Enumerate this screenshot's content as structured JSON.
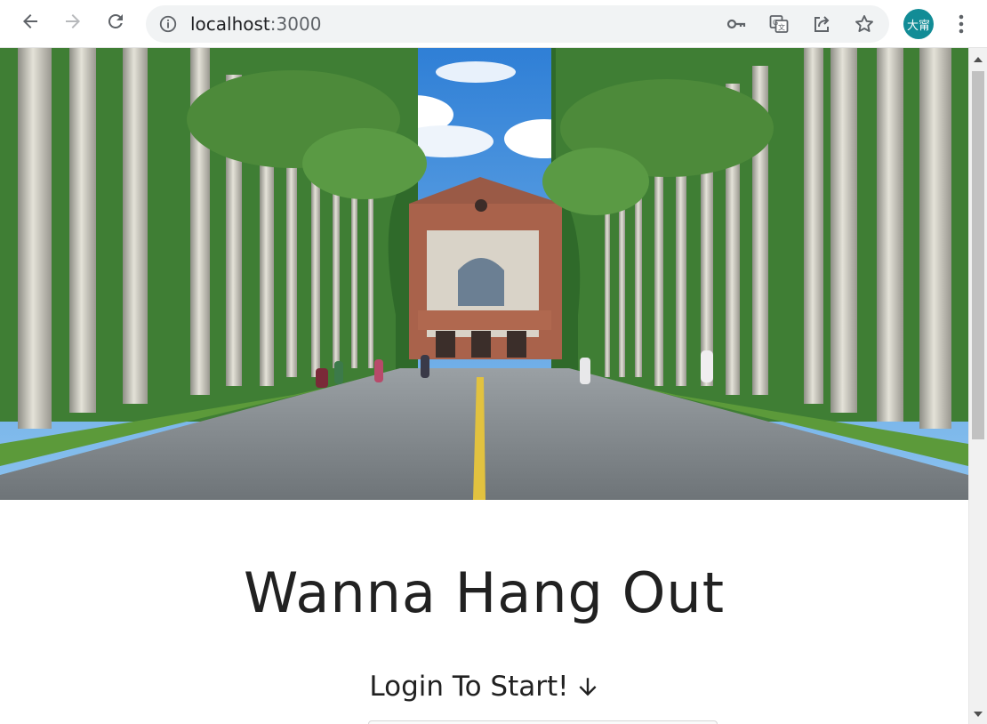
{
  "browser": {
    "url_host": "localhost",
    "url_port": ":3000",
    "profile_label": "大甯",
    "profile_color": "#128c96",
    "icons": {
      "back": "arrow-left-icon",
      "forward": "arrow-right-icon",
      "reload": "reload-icon",
      "site_info": "info-icon",
      "passwords": "key-icon",
      "translate": "translate-icon",
      "share": "share-icon",
      "bookmark": "star-icon",
      "menu": "more-vertical-icon"
    }
  },
  "page": {
    "hero_image": "campus-boulevard-palm-trees",
    "title": "Wanna Hang Out",
    "subtitle": "Login To Start!",
    "subtitle_icon": "arrow-down-icon",
    "text_color": "#212121"
  }
}
